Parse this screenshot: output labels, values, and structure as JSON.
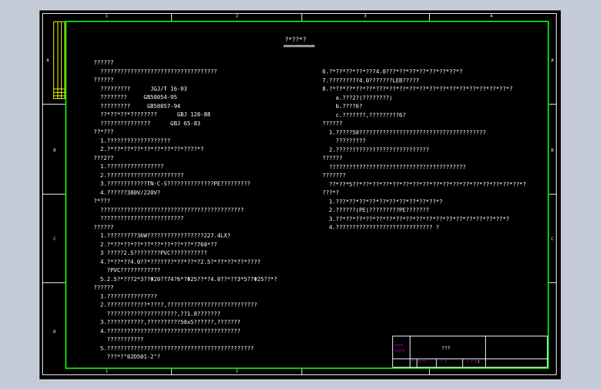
{
  "title": "?*??*?",
  "zones": {
    "top": [
      "1",
      "2",
      "3",
      "4"
    ],
    "bottom": [
      "1",
      "2"
    ],
    "left": [
      "A",
      "B",
      "C",
      "D"
    ],
    "right": [
      "A",
      "B",
      "C"
    ]
  },
  "left_column": [
    "??????",
    "  ???????????????????????????????????",
    "??????",
    "  ?????????      JGJ/T 16-93",
    "  ????????     GB50054-95",
    "  ?????????     GB50057-94",
    "  ??*??*??*????????      GBJ 120-88",
    "  ???????????????      GBJ 65-83",
    "??*???",
    "  1.???????????????????",
    "  2.?*??*??*??*??*??*??*??*????*?",
    "???2??",
    "  1.?????????????????",
    "  2.???????????????????????",
    "  3.????????????TN-C-S??????????????PE?????????",
    "  4.??????380V/220V?",
    "?*???",
    "  ???????????????????????????????????????????",
    "  ?????????????????????????",
    "??????",
    "  1.?????????36W?????????????????227.4LX?",
    "  2.?*??*??*??*??*??*??*??*??*?760*??",
    "  3 ?????2.5????????PVC???????????",
    "  4.?*??*??4.0??*???????*??*??*?2.5?*??*??*??*????",
    "    ?PVC????????????",
    "  5.2.5?*???2*3??Φ20??74?6*?Φ25??*?4.0??*??3*5??Φ25??*?",
    "??????",
    "  1.???????????????",
    "  2.????????????*????,???????????????????????????",
    "    ?????????????????????,??1.8???????",
    "  3.???????????,??????????50x5??????,???????",
    "  4.????????????????????????????????????????",
    "    ???????????",
    "  5.????????????????????????????????????????????",
    "    ???*?\"02D501-2\"?"
  ],
  "right_column": [
    "6.?*??*??*??*???4.0???*??*??*??*??*??*??*?",
    "7.?????????4.0???????LEB?????",
    "8.?*??*??*??*??*???*??*??*??*??*??*??*??*??*??*??*??*??*?",
    "    a.???2?(????????)",
    "    b.????6?",
    "    c.???????,?????????6?",
    "??????",
    "  1.?????50??????????????????????????????????????",
    "    ?????????",
    "  2.????????????????????????????",
    "??????",
    "  ?????????????????????????????????????????",
    "???????",
    "  ??*??*5??*??*??*??*??*??*??*??*??*??*??*??*??*??*??*??*??*?",
    "???*?",
    "  1.???*??*??*??*??*??*??*??*??*??*?",
    "  2.??????(PE)?????????PE???????",
    "  3.??*??*??*??*??*??*??*??*??*??*??*??*??*??*??*??*??*?",
    "  4.????????????????????????????? ?"
  ],
  "title_block": {
    "drawing_name": "???",
    "left_top": "????",
    "left_bottom": "?????",
    "row_labels": [
      "?? ??",
      "??",
      "? ?",
      "? ? ?"
    ],
    "page_no": "1"
  },
  "colors": {
    "line": "#00e000",
    "text": "#ffffff",
    "accent": "#ff00ff",
    "grid": "#ffff00"
  }
}
